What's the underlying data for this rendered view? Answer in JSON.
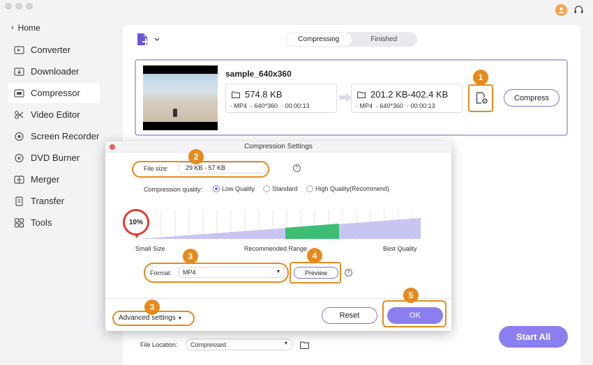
{
  "sidebar": {
    "home_label": "Home",
    "items": [
      {
        "label": "Converter",
        "icon": "converter-icon",
        "active": false
      },
      {
        "label": "Downloader",
        "icon": "downloader-icon",
        "active": false
      },
      {
        "label": "Compressor",
        "icon": "compressor-icon",
        "active": true
      },
      {
        "label": "Video Editor",
        "icon": "video-editor-icon",
        "active": false
      },
      {
        "label": "Screen Recorder",
        "icon": "screen-recorder-icon",
        "active": false
      },
      {
        "label": "DVD Burner",
        "icon": "dvd-burner-icon",
        "active": false
      },
      {
        "label": "Merger",
        "icon": "merger-icon",
        "active": false
      },
      {
        "label": "Transfer",
        "icon": "transfer-icon",
        "active": false
      },
      {
        "label": "Tools",
        "icon": "tools-icon",
        "active": false
      }
    ]
  },
  "tabs": [
    {
      "label": "Compressing",
      "active": true
    },
    {
      "label": "Finished",
      "active": false
    }
  ],
  "file": {
    "name": "sample_640x360",
    "source": {
      "size": "574.8 KB",
      "format": "MP4",
      "resolution": "640*360",
      "duration": "00:00:13"
    },
    "target": {
      "size": "201.2 KB-402.4 KB",
      "format": "MP4",
      "resolution": "640*360",
      "duration": "00:00:13"
    },
    "compress_label": "Compress"
  },
  "dialog": {
    "title": "Compression Settings",
    "file_size_label": "File size:",
    "file_size_value": "29 KB - 57 KB",
    "quality_label": "Compression quality:",
    "quality_options": [
      "Low Quality",
      "Standard",
      "High Quality(Recommend)"
    ],
    "quality_selected": "Low Quality",
    "slider_percent": "10%",
    "slider_value": 10,
    "slider_labels": {
      "left": "Small Size",
      "middle": "Recommended Range",
      "right": "Best Quality"
    },
    "format_label": "Format:",
    "format_value": "MP4",
    "preview_label": "Preview",
    "advanced_label": "Advanced settings",
    "reset_label": "Reset",
    "ok_label": "OK",
    "help_glyph": "?"
  },
  "bottom": {
    "file_location_label": "File Location:",
    "file_location_value": "Compressed",
    "start_all_label": "Start All"
  },
  "badges": [
    "1",
    "2",
    "3",
    "4",
    "3",
    "5"
  ],
  "colors": {
    "accent": "#8b7ff0",
    "highlight": "#e68a1c",
    "recommended": "#3dbd73",
    "slider_fill": "#c8c5f2"
  }
}
